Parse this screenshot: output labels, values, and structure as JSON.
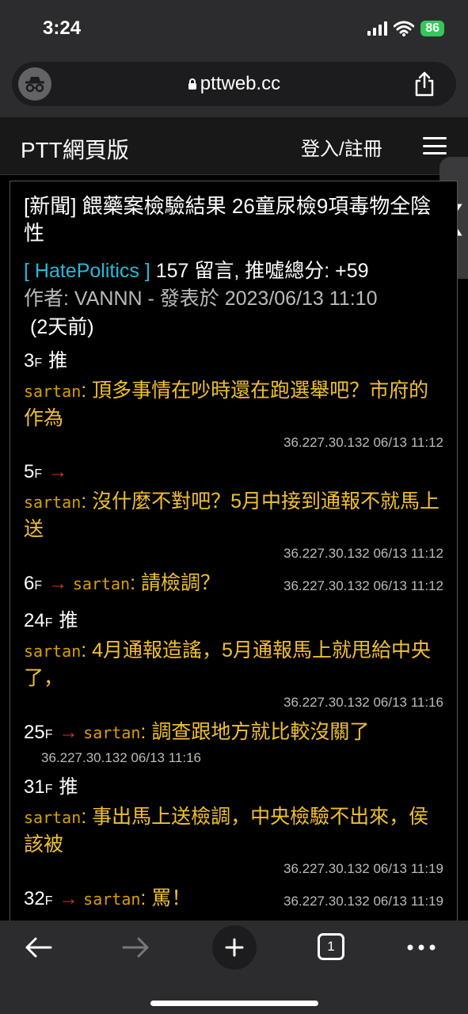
{
  "status": {
    "time": "3:24",
    "battery": "86"
  },
  "browser": {
    "url": "pttweb.cc",
    "tab_count": "1"
  },
  "site": {
    "title": "PTT網頁版",
    "login": "登入/註冊",
    "side_tab_glyph": "❮"
  },
  "article": {
    "title": "[新聞] 餵藥案檢驗結果 26童尿檢9項毒物全陰性",
    "board": "[ HatePolitics ]",
    "stats": "157 留言, 推噓總分: +59",
    "author_line": "作者: VANNN - 發表於 2023/06/13 11:10",
    "relative_time": "(2天前)"
  },
  "comments": [
    {
      "floor": "3",
      "tag": "推",
      "user": "sartan",
      "text": "頂多事情在吵時還在跑選舉吧？市府的作為",
      "ip": "36.227.30.132 06/13 11:12"
    },
    {
      "floor": "5",
      "tag": "→",
      "user": "sartan",
      "text": "沒什麼不對吧？5月中接到通報不就馬上送",
      "ip": "36.227.30.132 06/13 11:12"
    },
    {
      "floor": "6",
      "tag": "→",
      "user": "sartan",
      "text": "請檢調？",
      "ip": "36.227.30.132 06/13 11:12"
    },
    {
      "floor": "24",
      "tag": "推",
      "user": "sartan",
      "text": "4月通報造謠，5月通報馬上就甩給中央了，",
      "ip": "36.227.30.132 06/13 11:16"
    },
    {
      "floor": "25",
      "tag": "→",
      "user": "sartan",
      "text": "調查跟地方就比較沒關了",
      "ip": "36.227.30.132 06/13 11:16"
    },
    {
      "floor": "31",
      "tag": "推",
      "user": "sartan",
      "text": "事出馬上送檢調，中央檢驗不出來，侯該被",
      "ip": "36.227.30.132 06/13 11:19"
    },
    {
      "floor": "32",
      "tag": "→",
      "user": "sartan",
      "text": "罵！",
      "ip": "36.227.30.132 06/13 11:19"
    }
  ],
  "floor_suffix": "F",
  "colors": {
    "board": "#2ab8d8",
    "arrow": "#e03030",
    "comment_text": "#f0c030",
    "user": "#d9a000"
  },
  "icons": [
    "incognito-icon",
    "lock-icon",
    "share-icon",
    "menu-icon",
    "back-icon",
    "forward-icon",
    "plus-icon",
    "tabs-icon",
    "more-icon"
  ]
}
